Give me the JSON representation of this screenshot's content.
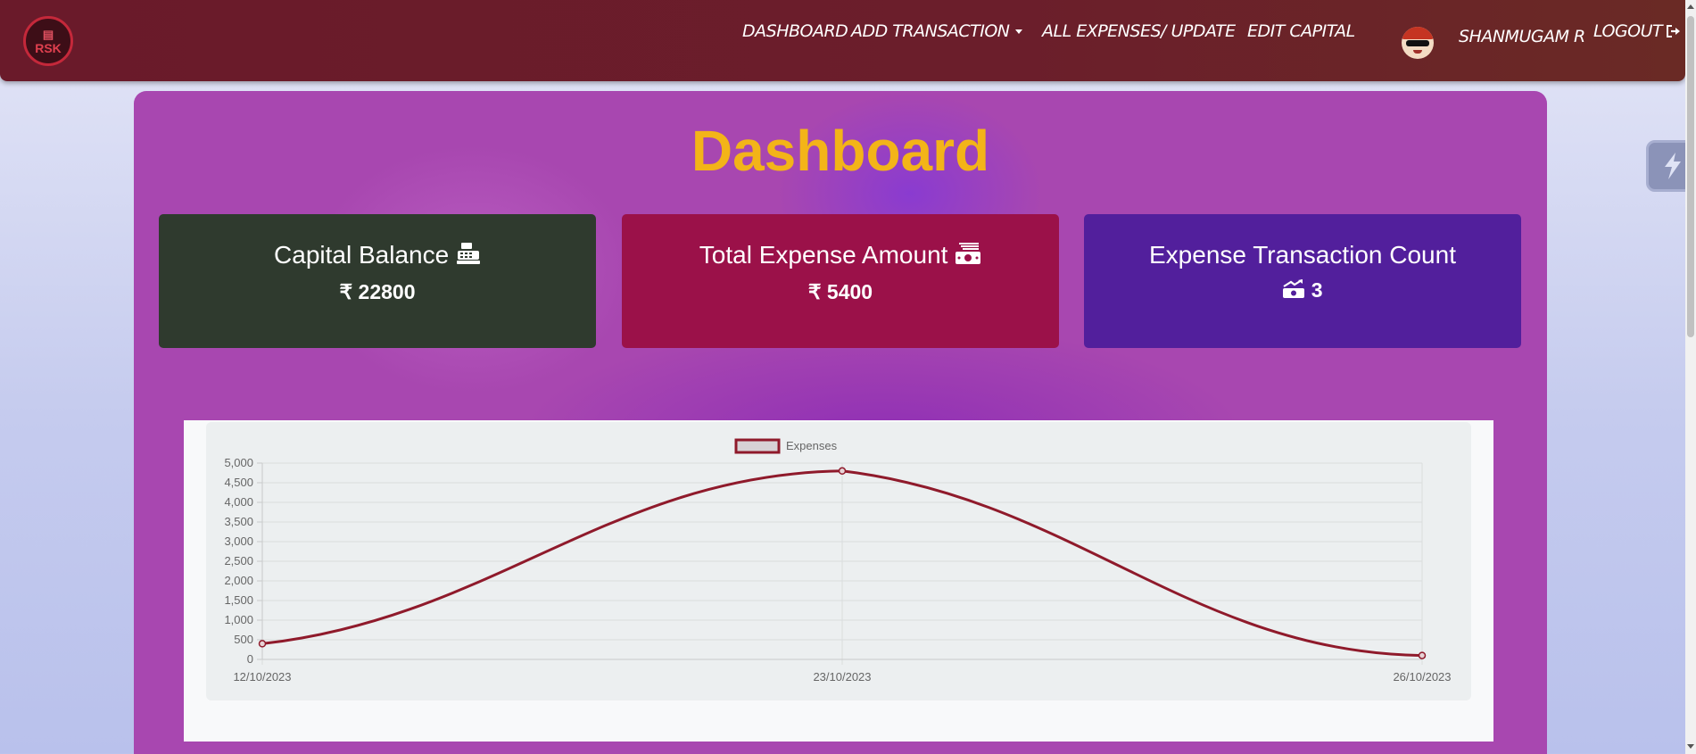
{
  "navbar": {
    "logo_text": "RSK",
    "items": [
      {
        "label": "Dashboard"
      },
      {
        "label": "Add Transaction"
      },
      {
        "label": "All Expenses/ Update"
      },
      {
        "label": "Edit Capital"
      }
    ],
    "user_name": "Shanmugam R",
    "logout_label": "Logout"
  },
  "page": {
    "title": "Dashboard"
  },
  "cards": [
    {
      "title": "Capital Balance",
      "value": "₹ 22800",
      "icon": "cash-register-icon",
      "color": "#2f3a2e"
    },
    {
      "title": "Total Expense Amount",
      "value": "₹ 5400",
      "icon": "money-bill-icon",
      "color": "#9b1149"
    },
    {
      "title": "Expense Transaction Count",
      "value": "3",
      "icon": "money-bill-trend-up-icon",
      "color": "#521f9c"
    }
  ],
  "colors": {
    "navbar": "#6a1a2a",
    "title": "#f3b418",
    "line": "#8f1a2b"
  },
  "chart_data": {
    "type": "line",
    "categories": [
      "12/10/2023",
      "23/10/2023",
      "26/10/2023"
    ],
    "series": [
      {
        "name": "Expenses",
        "values": [
          400,
          4800,
          100
        ]
      }
    ],
    "ylim": [
      0,
      5000
    ],
    "yticks": [
      0,
      500,
      1000,
      1500,
      2000,
      2500,
      3000,
      3500,
      4000,
      4500,
      5000
    ],
    "grid": true,
    "legend": "top-center"
  }
}
